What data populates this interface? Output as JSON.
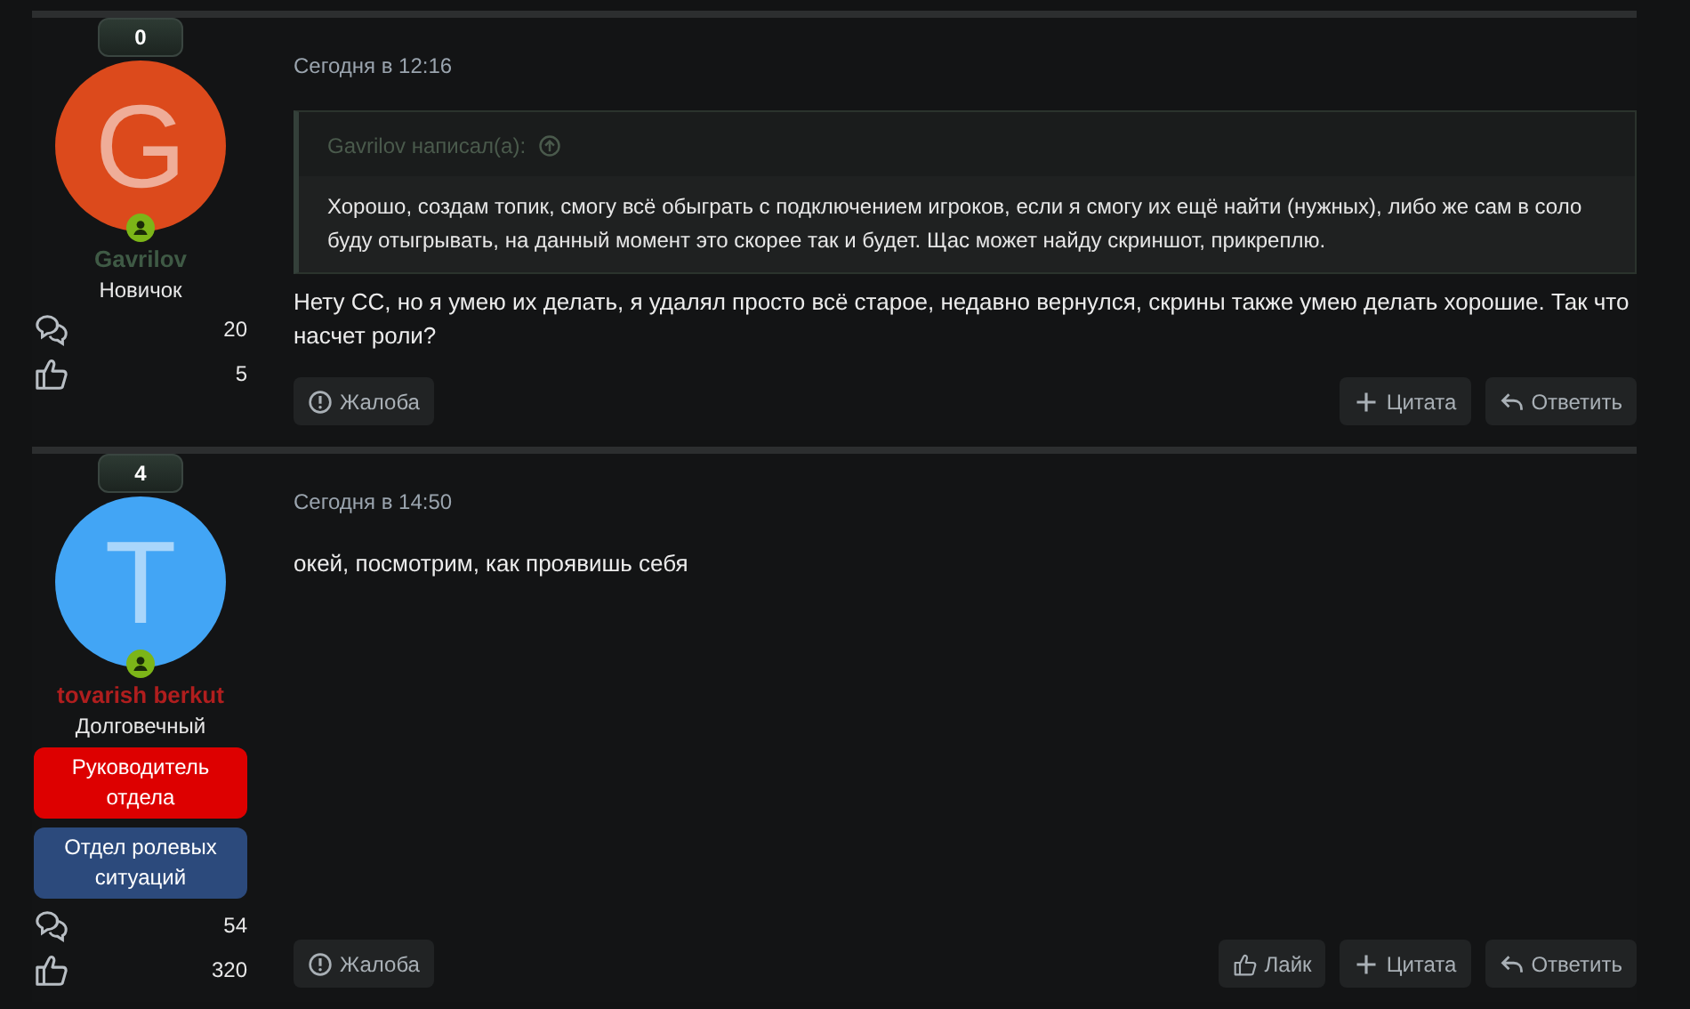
{
  "posts": [
    {
      "badge_count": "0",
      "avatar": {
        "letter": "G",
        "color": "#dc4a1c"
      },
      "online": true,
      "user": {
        "name": "Gavrilov",
        "color": "#3f5a45"
      },
      "user_title": "Новичок",
      "stats": [
        {
          "kind": "messages",
          "value": "20"
        },
        {
          "kind": "likes",
          "value": "5"
        }
      ],
      "date": "Сегодня в 12:16",
      "quote": {
        "author": "Gavrilov написал(а):",
        "text": "Хорошо, создам топик, смогу всё обыграть с подключением игроков, если я смогу их ещё найти (нужных), либо же сам в соло буду отыгрывать, на данный момент это скорее так и будет. Щас может найду скриншот, прикреплю."
      },
      "text": "Нету СС, но я умею их делать, я удалял просто всё старое, недавно вернулся, скрины также умею делать хорошие. Так что насчет роли?",
      "actions": [
        {
          "kind": "report",
          "label": "Жалоба"
        },
        {
          "kind": "quote",
          "label": "Цитата"
        },
        {
          "kind": "reply",
          "label": "Ответить"
        }
      ]
    },
    {
      "badge_count": "4",
      "avatar": {
        "letter": "T",
        "color": "#42a5f5"
      },
      "online": true,
      "user": {
        "name": "tovarish berkut",
        "color": "#b01e1e"
      },
      "user_title": "Долговечный",
      "roles": [
        {
          "label": "Руководитель отдела",
          "color": "#dd0000"
        },
        {
          "label": "Отдел ролевых ситуаций",
          "color": "#2c4a7c"
        }
      ],
      "stats": [
        {
          "kind": "messages",
          "value": "54"
        },
        {
          "kind": "likes",
          "value": "320"
        }
      ],
      "date": "Сегодня в 14:50",
      "text": "окей, посмотрим, как проявишь себя",
      "actions": [
        {
          "kind": "report",
          "label": "Жалоба"
        },
        {
          "kind": "like",
          "label": "Лайк"
        },
        {
          "kind": "quote",
          "label": "Цитата"
        },
        {
          "kind": "reply",
          "label": "Ответить"
        }
      ]
    }
  ]
}
